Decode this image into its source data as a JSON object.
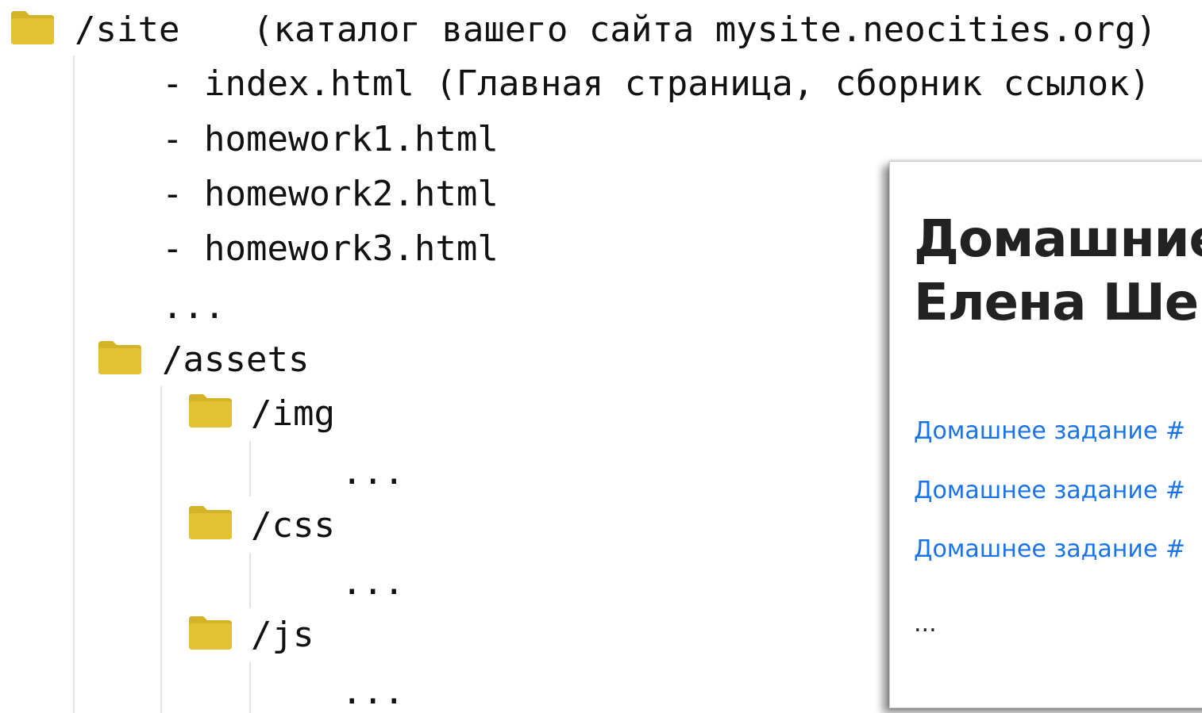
{
  "root": {
    "name": "/site",
    "comment": "(каталог вашего сайта mysite.neocities.org)",
    "icon": "folder-icon"
  },
  "files": [
    "- index.html (Главная страница, сборник ссылок)",
    "- homework1.html",
    "- homework2.html",
    "- homework3.html"
  ],
  "root_ellipsis": "...",
  "assets": {
    "name": "/assets",
    "icon": "folder-icon",
    "subfolders": [
      {
        "name": "/img",
        "icon": "folder-icon",
        "content": "..."
      },
      {
        "name": "/css",
        "icon": "folder-icon",
        "content": "..."
      },
      {
        "name": "/js",
        "icon": "folder-icon",
        "content": "..."
      }
    ]
  },
  "preview": {
    "title_line1": "Домашние",
    "title_line2": "Елена Шев",
    "links": [
      "Домашнее задание #",
      "Домашнее задание #",
      "Домашнее задание #"
    ],
    "ellipsis": "..."
  },
  "colors": {
    "folder": "#e2c233",
    "folder_tab": "#d4b22a",
    "link": "#1a73e8",
    "guide": "#e3e3e3"
  }
}
